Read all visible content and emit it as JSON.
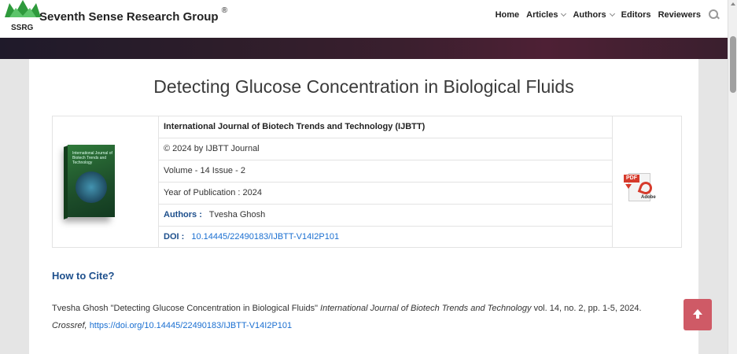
{
  "header": {
    "logo_text": "SSRG",
    "brand": "Seventh Sense Research Group",
    "brand_mark": "®",
    "nav": [
      {
        "label": "Home",
        "dropdown": false
      },
      {
        "label": "Articles",
        "dropdown": true
      },
      {
        "label": "Authors",
        "dropdown": true
      },
      {
        "label": "Editors",
        "dropdown": false
      },
      {
        "label": "Reviewers",
        "dropdown": false
      }
    ],
    "search_icon": "search-icon"
  },
  "article": {
    "title": "Detecting Glucose Concentration in Biological Fluids",
    "journal": "International Journal of Biotech Trends and Technology  (IJBTT)",
    "copyright": "© 2024 by IJBTT Journal",
    "volume": "Volume - 14 Issue - 2",
    "year": "Year of Publication : 2024",
    "authors_label": "Authors :",
    "authors": "Tvesha Ghosh",
    "doi_label": "DOI :",
    "doi": "10.14445/22490183/IJBTT-V14I2P101",
    "cover_title": "International Journal of Biotech Trends and Technology",
    "pdf_tag": "PDF",
    "pdf_brand": "Adobe"
  },
  "cite": {
    "heading": "How to Cite?",
    "text_plain": "Tvesha Ghosh \"Detecting Glucose Concentration in Biological Fluids\"",
    "journal_italic": "International Journal of Biotech Trends and Technology",
    "details": " vol. 14, no. 2, pp. 1-5, 2024.",
    "crossref_label": "Crossref,",
    "crossref_url": "https://doi.org/10.14445/22490183/IJBTT-V14I2P101"
  },
  "colors": {
    "accent_blue": "#1d4f8c",
    "link": "#1a6fd1",
    "back_to_top": "#cf5a66"
  }
}
